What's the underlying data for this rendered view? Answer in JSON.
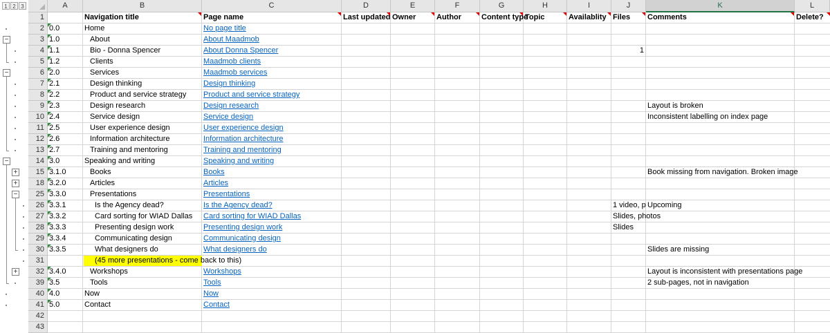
{
  "outline": {
    "levels": [
      "1",
      "2",
      "3"
    ],
    "row_buttons": [
      {
        "row": "3",
        "symbol": "−",
        "level": 1
      },
      {
        "row": "6",
        "symbol": "−",
        "level": 1
      },
      {
        "row": "14",
        "symbol": "−",
        "level": 1
      },
      {
        "row": "15",
        "symbol": "+",
        "level": 2
      },
      {
        "row": "18",
        "symbol": "+",
        "level": 2
      },
      {
        "row": "25",
        "symbol": "−",
        "level": 2
      },
      {
        "row": "32",
        "symbol": "+",
        "level": 2
      }
    ]
  },
  "columns": [
    {
      "letter": "A",
      "header": ""
    },
    {
      "letter": "B",
      "header": "Navigation title"
    },
    {
      "letter": "C",
      "header": "Page name"
    },
    {
      "letter": "D",
      "header": "Last updated"
    },
    {
      "letter": "E",
      "header": "Owner"
    },
    {
      "letter": "F",
      "header": "Author"
    },
    {
      "letter": "G",
      "header": "Content type"
    },
    {
      "letter": "H",
      "header": "Topic"
    },
    {
      "letter": "I",
      "header": "Availablity"
    },
    {
      "letter": "J",
      "header": "Files"
    },
    {
      "letter": "K",
      "header": "Comments"
    },
    {
      "letter": "L",
      "header": "Delete?"
    }
  ],
  "selected_column": "K",
  "rows": [
    {
      "num": "2",
      "id": "0.0",
      "title": "Home",
      "page": "No page title",
      "files": "",
      "comments": ""
    },
    {
      "num": "3",
      "id": "1.0",
      "title": "About",
      "page": "About Maadmob",
      "files": "",
      "comments": ""
    },
    {
      "num": "4",
      "id": "1.1",
      "title": "Bio - Donna Spencer",
      "page": "About Donna Spencer",
      "files": "1",
      "comments": ""
    },
    {
      "num": "5",
      "id": "1.2",
      "title": "Clients",
      "page": "Maadmob clients",
      "files": "",
      "comments": ""
    },
    {
      "num": "6",
      "id": "2.0",
      "title": "Services",
      "page": "Maadmob services",
      "files": "",
      "comments": ""
    },
    {
      "num": "7",
      "id": "2.1",
      "title": "Design thinking",
      "page": "Design thinking",
      "files": "",
      "comments": ""
    },
    {
      "num": "8",
      "id": "2.2",
      "title": "Product and service strategy",
      "page": "Product and service strategy",
      "files": "",
      "comments": ""
    },
    {
      "num": "9",
      "id": "2.3",
      "title": "Design research",
      "page": "Design research",
      "files": "",
      "comments": "Layout is broken"
    },
    {
      "num": "10",
      "id": "2.4",
      "title": "Service design",
      "page": "Service design",
      "files": "",
      "comments": "Inconsistent labelling on index page"
    },
    {
      "num": "11",
      "id": "2.5",
      "title": "User experience design",
      "page": "User experience design",
      "files": "",
      "comments": ""
    },
    {
      "num": "12",
      "id": "2.6",
      "title": "Information architecture",
      "page": "Information architecture",
      "files": "",
      "comments": ""
    },
    {
      "num": "13",
      "id": "2.7",
      "title": "Training and mentoring",
      "page": "Training and mentoring",
      "files": "",
      "comments": ""
    },
    {
      "num": "14",
      "id": "3.0",
      "title": "Speaking and writing",
      "page": "Speaking and writing",
      "files": "",
      "comments": ""
    },
    {
      "num": "15",
      "id": "3.1.0",
      "title": "Books",
      "page": "Books",
      "files": "",
      "comments": "Book missing from navigation. Broken image"
    },
    {
      "num": "18",
      "id": "3.2.0",
      "title": "Articles",
      "page": "Articles",
      "files": "",
      "comments": ""
    },
    {
      "num": "25",
      "id": "3.3.0",
      "title": "Presentations",
      "page": "Presentations",
      "files": "",
      "comments": ""
    },
    {
      "num": "26",
      "id": "3.3.1",
      "title": "Is the Agency dead?",
      "page": "Is the Agency dead?",
      "files": "1 video, p",
      "comments": "Upcoming"
    },
    {
      "num": "27",
      "id": "3.3.2",
      "title": "Card sorting for WIAD Dallas",
      "page": "Card sorting for WIAD Dallas",
      "files": "Slides, photos",
      "comments": ""
    },
    {
      "num": "28",
      "id": "3.3.3",
      "title": "Presenting design work",
      "page": "Presenting design work",
      "files": "Slides",
      "comments": ""
    },
    {
      "num": "29",
      "id": "3.3.4",
      "title": "Communicating design",
      "page": "Communicating design",
      "files": "",
      "comments": ""
    },
    {
      "num": "30",
      "id": "3.3.5",
      "title": "What designers do",
      "page": "What designers do",
      "files": "",
      "comments": "Slides are missing"
    },
    {
      "num": "31",
      "id": "",
      "title": "(45 more presentations - come back to this)",
      "page": "",
      "files": "",
      "comments": ""
    },
    {
      "num": "32",
      "id": "3.4.0",
      "title": "Workshops",
      "page": "Workshops",
      "files": "",
      "comments": "Layout is inconsistent with presentations page"
    },
    {
      "num": "39",
      "id": "3.5",
      "title": "Tools",
      "page": "Tools",
      "files": "",
      "comments": "2 sub-pages, not in navigation"
    },
    {
      "num": "40",
      "id": "4.0",
      "title": "Now",
      "page": "Now",
      "files": "",
      "comments": ""
    },
    {
      "num": "41",
      "id": "5.0",
      "title": "Contact",
      "page": "Contact",
      "files": "",
      "comments": ""
    },
    {
      "num": "42",
      "id": "",
      "title": "",
      "page": "",
      "files": "",
      "comments": ""
    },
    {
      "num": "43",
      "id": "",
      "title": "",
      "page": "",
      "files": "",
      "comments": ""
    }
  ],
  "header_row_num": "1",
  "colors": {
    "link": "#0563c1",
    "highlight": "#ffff00",
    "accent": "#217346",
    "note_marker": "#e00000"
  }
}
